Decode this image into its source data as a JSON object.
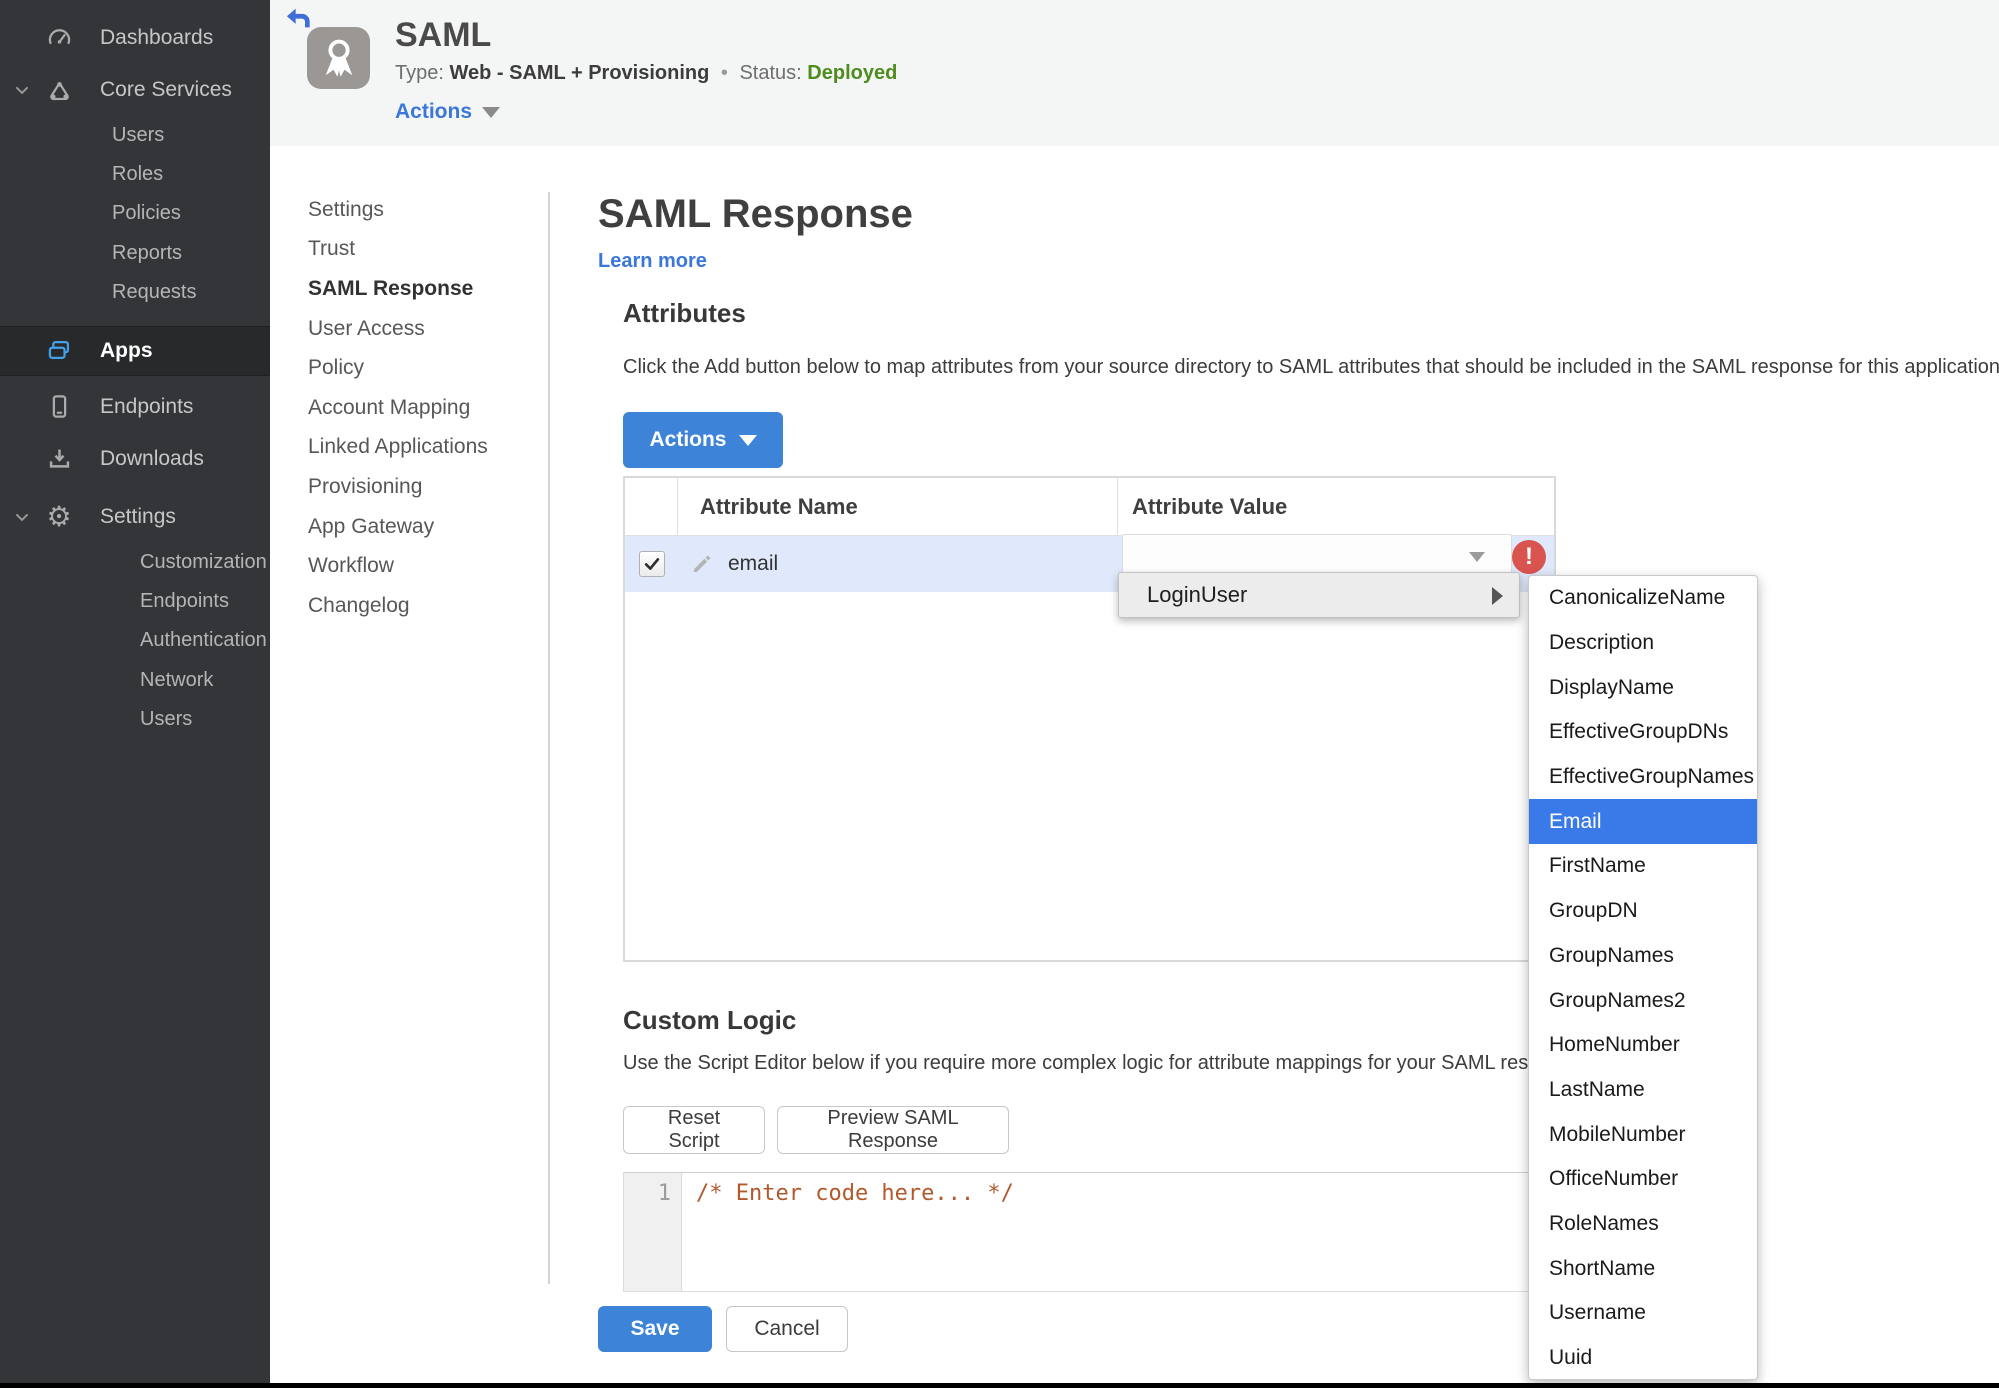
{
  "colors": {
    "accent_blue": "#3d84d8",
    "link_blue": "#3b77d8",
    "status_green": "#4d8c1d",
    "error_red": "#d9534f",
    "menu_highlight_blue": "#3a79e8",
    "row_highlight_blue": "#dfe9fb",
    "sidebar_dark": "#333538"
  },
  "sidebar": {
    "items": [
      {
        "name": "dashboards",
        "label": "Dashboards",
        "icon": "gauge-icon",
        "level": 1
      },
      {
        "name": "core-services",
        "label": "Core Services",
        "icon": "core-services-icon",
        "level": 1,
        "chevron": true
      },
      {
        "name": "users",
        "label": "Users",
        "level": 2,
        "group": "core"
      },
      {
        "name": "roles",
        "label": "Roles",
        "level": 2,
        "group": "core"
      },
      {
        "name": "policies",
        "label": "Policies",
        "level": 2,
        "group": "core"
      },
      {
        "name": "reports",
        "label": "Reports",
        "level": 2,
        "group": "core"
      },
      {
        "name": "requests",
        "label": "Requests",
        "level": 2,
        "group": "core"
      },
      {
        "name": "apps",
        "label": "Apps",
        "icon": "apps-icon",
        "level": 1,
        "active": true
      },
      {
        "name": "endpoints",
        "label": "Endpoints",
        "icon": "phone-icon",
        "level": 1
      },
      {
        "name": "downloads",
        "label": "Downloads",
        "icon": "download-icon",
        "level": 1
      },
      {
        "name": "settings",
        "label": "Settings",
        "icon": "gear-icon",
        "level": 1,
        "chevron": true
      },
      {
        "name": "customization",
        "label": "Customization",
        "level": 2,
        "group": "settings"
      },
      {
        "name": "endpoints-settings",
        "label": "Endpoints",
        "level": 2,
        "group": "settings"
      },
      {
        "name": "authentication",
        "label": "Authentication",
        "level": 2,
        "group": "settings"
      },
      {
        "name": "network",
        "label": "Network",
        "level": 2,
        "group": "settings"
      },
      {
        "name": "users-settings",
        "label": "Users",
        "level": 2,
        "group": "settings"
      }
    ]
  },
  "header": {
    "back_icon": "back-arrow-icon",
    "app_icon": "award-icon",
    "title": "SAML",
    "type_label": "Type:",
    "type_value": "Web - SAML + Provisioning",
    "separator": "•",
    "status_label": "Status:",
    "status_value": "Deployed",
    "actions_label": "Actions"
  },
  "subnav": {
    "items": [
      {
        "label": "Settings"
      },
      {
        "label": "Trust"
      },
      {
        "label": "SAML Response",
        "active": true
      },
      {
        "label": "User Access"
      },
      {
        "label": "Policy"
      },
      {
        "label": "Account Mapping"
      },
      {
        "label": "Linked Applications"
      },
      {
        "label": "Provisioning"
      },
      {
        "label": "App Gateway"
      },
      {
        "label": "Workflow"
      },
      {
        "label": "Changelog"
      }
    ]
  },
  "main": {
    "title": "SAML Response",
    "learn_more": "Learn more",
    "attributes": {
      "heading": "Attributes",
      "description": "Click the Add button below to map attributes from your source directory to SAML attributes that should be included in the SAML response for this application.",
      "actions_label": "Actions"
    },
    "table": {
      "columns": [
        "Attribute Name",
        "Attribute Value"
      ],
      "row": {
        "checked": true,
        "name": "email",
        "value": ""
      }
    },
    "value_menu": {
      "item_label": "LoginUser"
    },
    "attribute_submenu": {
      "selected": "Email",
      "items": [
        {
          "label": "CanonicalizeName"
        },
        {
          "label": "Description"
        },
        {
          "label": "DisplayName"
        },
        {
          "label": "EffectiveGroupDNs"
        },
        {
          "label": "EffectiveGroupNames"
        },
        {
          "label": "Email",
          "selected": true
        },
        {
          "label": "FirstName"
        },
        {
          "label": "GroupDN"
        },
        {
          "label": "GroupNames"
        },
        {
          "label": "GroupNames2"
        },
        {
          "label": "HomeNumber"
        },
        {
          "label": "LastName"
        },
        {
          "label": "MobileNumber"
        },
        {
          "label": "OfficeNumber"
        },
        {
          "label": "RoleNames"
        },
        {
          "label": "ShortName"
        },
        {
          "label": "Username"
        },
        {
          "label": "Uuid"
        }
      ]
    },
    "custom_logic": {
      "heading": "Custom Logic",
      "description": "Use the Script Editor below if you require more complex logic for attribute mappings for your SAML response.",
      "reset_label": "Reset Script",
      "preview_label": "Preview SAML Response"
    },
    "editor": {
      "line_number": "1",
      "code": "/* Enter code here... */"
    },
    "footer": {
      "save_label": "Save",
      "cancel_label": "Cancel"
    }
  }
}
